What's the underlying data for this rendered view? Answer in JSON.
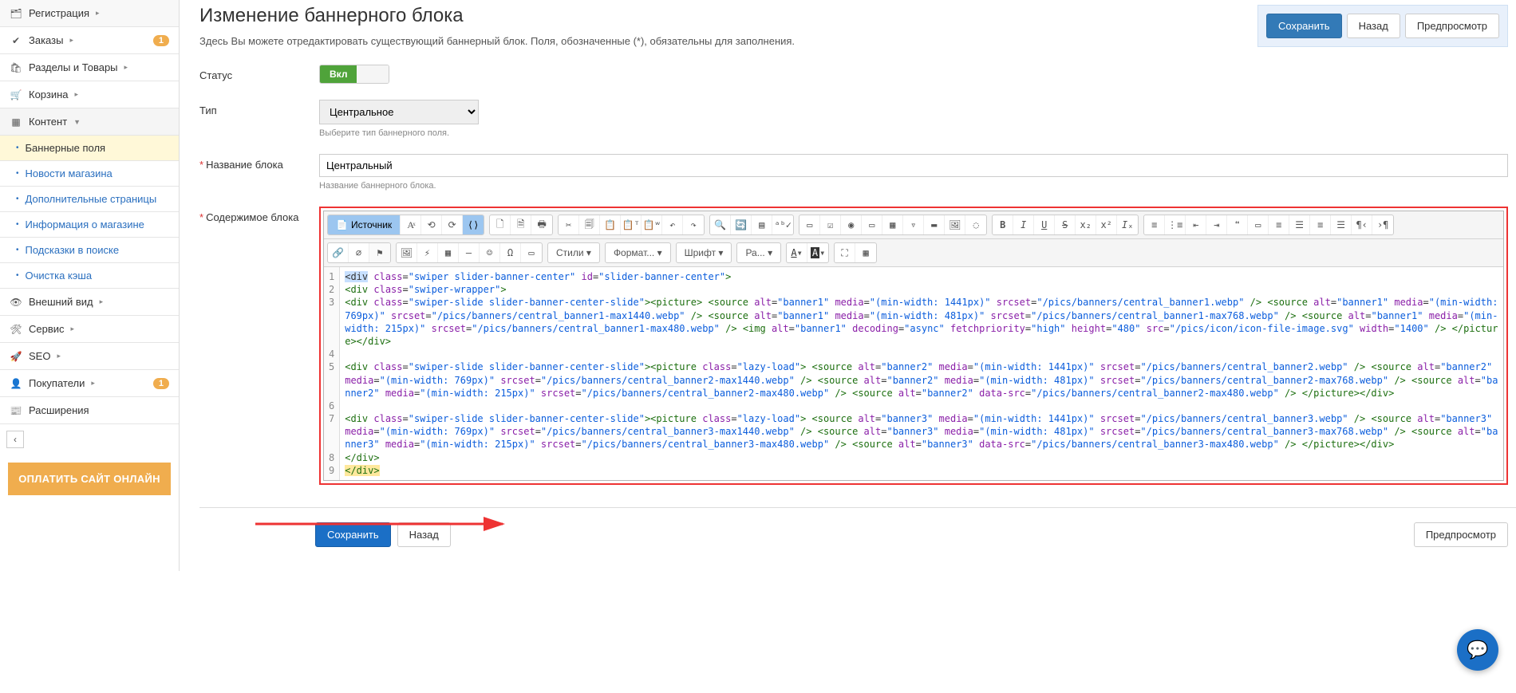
{
  "sidebar": {
    "items": [
      {
        "glyph": "🗂",
        "label": "Регистрация",
        "caret": true
      },
      {
        "glyph": "✔",
        "label": "Заказы",
        "caret": true,
        "badge": "1"
      },
      {
        "glyph": "🛍",
        "label": "Разделы и Товары",
        "caret": true
      },
      {
        "glyph": "🛒",
        "label": "Корзина",
        "caret": true
      },
      {
        "glyph": "▦",
        "label": "Контент",
        "caret": true,
        "caret_down": true,
        "active": true
      },
      {
        "glyph": "👁",
        "label": "Внешний вид",
        "caret": true
      },
      {
        "glyph": "🛠",
        "label": "Сервис",
        "caret": true
      },
      {
        "glyph": "🚀",
        "label": "SEO",
        "caret": true
      },
      {
        "glyph": "👤",
        "label": "Покупатели",
        "caret": true,
        "badge": "1"
      },
      {
        "glyph": "📰",
        "label": "Расширения"
      }
    ],
    "sub": [
      {
        "label": "Баннерные поля",
        "selected": true
      },
      {
        "label": "Новости магазина"
      },
      {
        "label": "Дополнительные страницы"
      },
      {
        "label": "Информация о магазине"
      },
      {
        "label": "Подсказки в поиске"
      },
      {
        "label": "Очистка кэша"
      }
    ],
    "collapse": "‹",
    "pay": "ОПЛАТИТЬ САЙТ ОНЛАЙН"
  },
  "header": {
    "title": "Изменение баннерного блока",
    "desc": "Здесь Вы можете отредактировать существующий баннерный блок. Поля, обозначенные (*), обязательны для заполнения."
  },
  "topActions": {
    "save": "Сохранить",
    "back": "Назад",
    "preview": "Предпросмотр"
  },
  "form": {
    "status": {
      "label": "Статус",
      "on": "Вкл"
    },
    "type": {
      "label": "Тип",
      "value": "Центральное",
      "help": "Выберите тип баннерного поля."
    },
    "name": {
      "label": "Название блока",
      "value": "Центральный",
      "help": "Название баннерного блока."
    },
    "content": {
      "label": "Содержимое блока"
    }
  },
  "editor": {
    "sourceBtn": "Источник",
    "styleDrop": "Стили",
    "formatDrop": "Формат...",
    "fontDrop": "Шрифт",
    "sizeDrop": "Ра...",
    "lines": [
      {
        "n": "1",
        "html": "<span class='c-hl'>&lt;div</span> <span class='c-attr'>class</span>=<span class='c-val'>\"swiper slider-banner-center\"</span> <span class='c-attr'>id</span>=<span class='c-val'>\"slider-banner-center\"</span><span class='c-tag'>&gt;</span>"
      },
      {
        "n": "2",
        "html": "<span class='c-tag'>&lt;div</span> <span class='c-attr'>class</span>=<span class='c-val'>\"swiper-wrapper\"</span><span class='c-tag'>&gt;</span>"
      },
      {
        "n": "3",
        "html": "<span class='c-tag'>&lt;div</span> <span class='c-attr'>class</span>=<span class='c-val'>\"swiper-slide slider-banner-center-slide\"</span><span class='c-tag'>&gt;&lt;picture&gt;</span> <span class='c-tag'>&lt;source</span> <span class='c-attr'>alt</span>=<span class='c-val'>\"banner1\"</span> <span class='c-attr'>media</span>=<span class='c-val'>\"(min-width: 1441px)\"</span> <span class='c-attr'>srcset</span>=<span class='c-val'>\"/pics/banners/central_banner1.webp\"</span> <span class='c-tag'>/&gt;</span> <span class='c-tag'>&lt;source</span> <span class='c-attr'>alt</span>=<span class='c-val'>\"banner1\"</span> <span class='c-attr'>media</span>=<span class='c-val'>\"(min-width: 769px)\"</span> <span class='c-attr'>srcset</span>=<span class='c-val'>\"/pics/banners/central_banner1-max1440.webp\"</span> <span class='c-tag'>/&gt;</span> <span class='c-tag'>&lt;source</span> <span class='c-attr'>alt</span>=<span class='c-val'>\"banner1\"</span> <span class='c-attr'>media</span>=<span class='c-val'>\"(min-width: 481px)\"</span> <span class='c-attr'>srcset</span>=<span class='c-val'>\"/pics/banners/central_banner1-max768.webp\"</span> <span class='c-tag'>/&gt;</span> <span class='c-tag'>&lt;source</span> <span class='c-attr'>alt</span>=<span class='c-val'>\"banner1\"</span> <span class='c-attr'>media</span>=<span class='c-val'>\"(min-width: 215px)\"</span> <span class='c-attr'>srcset</span>=<span class='c-val'>\"/pics/banners/central_banner1-max480.webp\"</span> <span class='c-tag'>/&gt;</span> <span class='c-tag'>&lt;img</span> <span class='c-attr'>alt</span>=<span class='c-val'>\"banner1\"</span> <span class='c-attr'>decoding</span>=<span class='c-val'>\"async\"</span> <span class='c-attr'>fetchpriority</span>=<span class='c-val'>\"high\"</span> <span class='c-attr'>height</span>=<span class='c-val'>\"480\"</span> <span class='c-attr'>src</span>=<span class='c-val'>\"/pics/icon/icon-file-image.svg\"</span> <span class='c-attr'>width</span>=<span class='c-val'>\"1400\"</span> <span class='c-tag'>/&gt;</span> <span class='c-tag'>&lt;/picture&gt;&lt;/div&gt;</span>"
      },
      {
        "n": "4",
        "html": ""
      },
      {
        "n": "5",
        "html": "<span class='c-tag'>&lt;div</span> <span class='c-attr'>class</span>=<span class='c-val'>\"swiper-slide slider-banner-center-slide\"</span><span class='c-tag'>&gt;&lt;picture</span> <span class='c-attr'>class</span>=<span class='c-val'>\"lazy-load\"</span><span class='c-tag'>&gt;</span> <span class='c-tag'>&lt;source</span> <span class='c-attr'>alt</span>=<span class='c-val'>\"banner2\"</span> <span class='c-attr'>media</span>=<span class='c-val'>\"(min-width: 1441px)\"</span> <span class='c-attr'>srcset</span>=<span class='c-val'>\"/pics/banners/central_banner2.webp\"</span> <span class='c-tag'>/&gt;</span> <span class='c-tag'>&lt;source</span> <span class='c-attr'>alt</span>=<span class='c-val'>\"banner2\"</span> <span class='c-attr'>media</span>=<span class='c-val'>\"(min-width: 769px)\"</span> <span class='c-attr'>srcset</span>=<span class='c-val'>\"/pics/banners/central_banner2-max1440.webp\"</span> <span class='c-tag'>/&gt;</span> <span class='c-tag'>&lt;source</span> <span class='c-attr'>alt</span>=<span class='c-val'>\"banner2\"</span> <span class='c-attr'>media</span>=<span class='c-val'>\"(min-width: 481px)\"</span> <span class='c-attr'>srcset</span>=<span class='c-val'>\"/pics/banners/central_banner2-max768.webp\"</span> <span class='c-tag'>/&gt;</span> <span class='c-tag'>&lt;source</span> <span class='c-attr'>alt</span>=<span class='c-val'>\"banner2\"</span> <span class='c-attr'>media</span>=<span class='c-val'>\"(min-width: 215px)\"</span> <span class='c-attr'>srcset</span>=<span class='c-val'>\"/pics/banners/central_banner2-max480.webp\"</span> <span class='c-tag'>/&gt;</span> <span class='c-tag'>&lt;source</span> <span class='c-attr'>alt</span>=<span class='c-val'>\"banner2\"</span> <span class='c-attr'>data-src</span>=<span class='c-val'>\"/pics/banners/central_banner2-max480.webp\"</span> <span class='c-tag'>/&gt;</span> <span class='c-tag'>&lt;/picture&gt;&lt;/div&gt;</span>"
      },
      {
        "n": "6",
        "html": ""
      },
      {
        "n": "7",
        "html": "<span class='c-tag'>&lt;div</span> <span class='c-attr'>class</span>=<span class='c-val'>\"swiper-slide slider-banner-center-slide\"</span><span class='c-tag'>&gt;&lt;picture</span> <span class='c-attr'>class</span>=<span class='c-val'>\"lazy-load\"</span><span class='c-tag'>&gt;</span> <span class='c-tag'>&lt;source</span> <span class='c-attr'>alt</span>=<span class='c-val'>\"banner3\"</span> <span class='c-attr'>media</span>=<span class='c-val'>\"(min-width: 1441px)\"</span> <span class='c-attr'>srcset</span>=<span class='c-val'>\"/pics/banners/central_banner3.webp\"</span> <span class='c-tag'>/&gt;</span> <span class='c-tag'>&lt;source</span> <span class='c-attr'>alt</span>=<span class='c-val'>\"banner3\"</span> <span class='c-attr'>media</span>=<span class='c-val'>\"(min-width: 769px)\"</span> <span class='c-attr'>srcset</span>=<span class='c-val'>\"/pics/banners/central_banner3-max1440.webp\"</span> <span class='c-tag'>/&gt;</span> <span class='c-tag'>&lt;source</span> <span class='c-attr'>alt</span>=<span class='c-val'>\"banner3\"</span> <span class='c-attr'>media</span>=<span class='c-val'>\"(min-width: 481px)\"</span> <span class='c-attr'>srcset</span>=<span class='c-val'>\"/pics/banners/central_banner3-max768.webp\"</span> <span class='c-tag'>/&gt;</span> <span class='c-tag'>&lt;source</span> <span class='c-attr'>alt</span>=<span class='c-val'>\"banner3\"</span> <span class='c-attr'>media</span>=<span class='c-val'>\"(min-width: 215px)\"</span> <span class='c-attr'>srcset</span>=<span class='c-val'>\"/pics/banners/central_banner3-max480.webp\"</span> <span class='c-tag'>/&gt;</span> <span class='c-tag'>&lt;source</span> <span class='c-attr'>alt</span>=<span class='c-val'>\"banner3\"</span> <span class='c-attr'>data-src</span>=<span class='c-val'>\"/pics/banners/central_banner3-max480.webp\"</span> <span class='c-tag'>/&gt;</span> <span class='c-tag'>&lt;/picture&gt;&lt;/div&gt;</span>"
      },
      {
        "n": "8",
        "html": "<span class='c-tag'>&lt;/div&gt;</span>"
      },
      {
        "n": "9",
        "html": "<span class='c-hl2 c-tag'>&lt;/div&gt;</span>"
      }
    ]
  },
  "bottomActions": {
    "save": "Сохранить",
    "back": "Назад",
    "preview": "Предпросмотр"
  }
}
